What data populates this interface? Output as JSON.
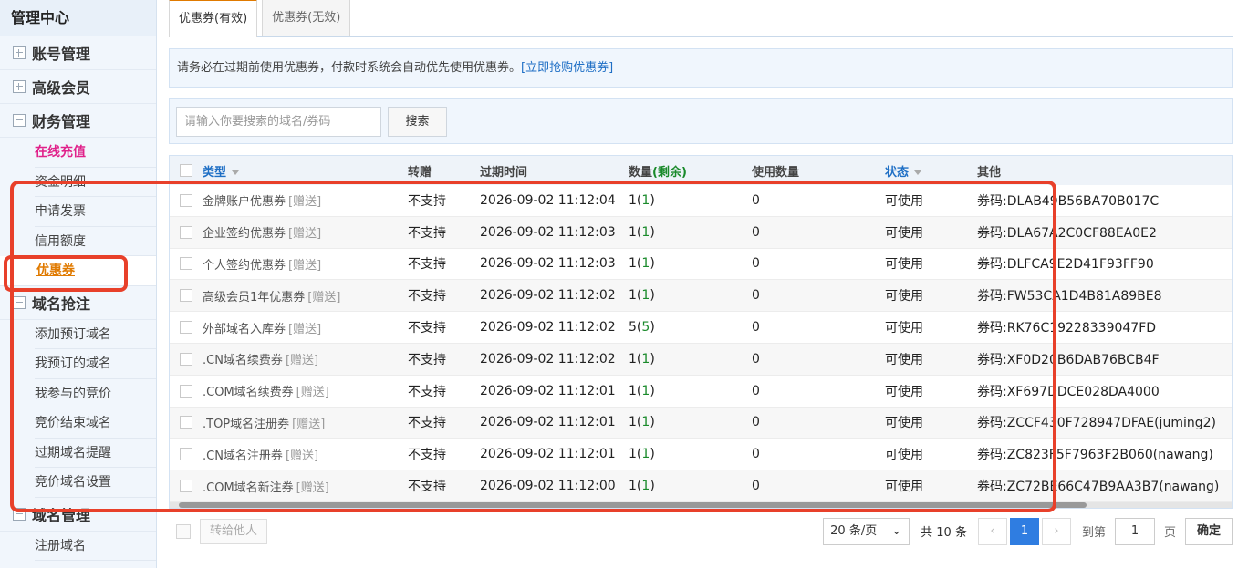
{
  "sidebar": {
    "title": "管理中心",
    "groups": [
      {
        "label": "账号管理",
        "expanded": false,
        "items": []
      },
      {
        "label": "高级会员",
        "expanded": false,
        "items": []
      },
      {
        "label": "财务管理",
        "expanded": true,
        "items": [
          "在线充值",
          "资金明细",
          "申请发票",
          "信用额度",
          "优惠券"
        ]
      },
      {
        "label": "域名抢注",
        "expanded": true,
        "items": [
          "添加预订域名",
          "我预订的域名",
          "我参与的竞价",
          "竞价结束域名",
          "过期域名提醒",
          "竞价域名设置"
        ]
      },
      {
        "label": "域名管理",
        "expanded": true,
        "items": [
          "注册域名"
        ]
      }
    ],
    "active_item": "优惠券",
    "highlight_item": "在线充值"
  },
  "tabs": [
    {
      "label": "优惠券(有效)",
      "active": true
    },
    {
      "label": "优惠券(无效)",
      "active": false
    }
  ],
  "notice": {
    "text": "请务必在过期前使用优惠券，付款时系统会自动优先使用优惠券。",
    "link": "[立即抢购优惠券]"
  },
  "search": {
    "placeholder": "请输入你要搜索的域名/券码",
    "button": "搜索"
  },
  "table": {
    "headers": {
      "type": "类型",
      "gift": "转赠",
      "expire": "过期时间",
      "qty": "数量",
      "qty_remain": "(剩余)",
      "used": "使用数量",
      "status": "状态",
      "other": "其他"
    },
    "rows": [
      {
        "type": "金牌账户优惠券",
        "tag": "[赠送]",
        "gift": "不支持",
        "expire": "2026-09-02 11:12:04",
        "qty": "1",
        "remain": "1",
        "used": "0",
        "status": "可使用",
        "other": "券码:DLAB49B56BA70B017C"
      },
      {
        "type": "企业签约优惠券",
        "tag": "[赠送]",
        "gift": "不支持",
        "expire": "2026-09-02 11:12:03",
        "qty": "1",
        "remain": "1",
        "used": "0",
        "status": "可使用",
        "other": "券码:DLA67A2C0CF88EA0E2"
      },
      {
        "type": "个人签约优惠券",
        "tag": "[赠送]",
        "gift": "不支持",
        "expire": "2026-09-02 11:12:03",
        "qty": "1",
        "remain": "1",
        "used": "0",
        "status": "可使用",
        "other": "券码:DLFCA9E2D41F93FF90"
      },
      {
        "type": "高级会员1年优惠券",
        "tag": "[赠送]",
        "gift": "不支持",
        "expire": "2026-09-02 11:12:02",
        "qty": "1",
        "remain": "1",
        "used": "0",
        "status": "可使用",
        "other": "券码:FW53CA1D4B81A89BE8"
      },
      {
        "type": "外部域名入库券",
        "tag": "[赠送]",
        "gift": "不支持",
        "expire": "2026-09-02 11:12:02",
        "qty": "5",
        "remain": "5",
        "used": "0",
        "status": "可使用",
        "other": "券码:RK76C19228339047FD"
      },
      {
        "type": ".CN域名续费券",
        "tag": "[赠送]",
        "gift": "不支持",
        "expire": "2026-09-02 11:12:02",
        "qty": "1",
        "remain": "1",
        "used": "0",
        "status": "可使用",
        "other": "券码:XF0D20B6DAB76BCB4F"
      },
      {
        "type": ".COM域名续费券",
        "tag": "[赠送]",
        "gift": "不支持",
        "expire": "2026-09-02 11:12:01",
        "qty": "1",
        "remain": "1",
        "used": "0",
        "status": "可使用",
        "other": "券码:XF697DDCE028DA4000"
      },
      {
        "type": ".TOP域名注册券",
        "tag": "[赠送]",
        "gift": "不支持",
        "expire": "2026-09-02 11:12:01",
        "qty": "1",
        "remain": "1",
        "used": "0",
        "status": "可使用",
        "other": "券码:ZCCF430F728947DFAE(juming2)"
      },
      {
        "type": ".CN域名注册券",
        "tag": "[赠送]",
        "gift": "不支持",
        "expire": "2026-09-02 11:12:01",
        "qty": "1",
        "remain": "1",
        "used": "0",
        "status": "可使用",
        "other": "券码:ZC823F5F7963F2B060(nawang)"
      },
      {
        "type": ".COM域名新注券",
        "tag": "[赠送]",
        "gift": "不支持",
        "expire": "2026-09-02 11:12:00",
        "qty": "1",
        "remain": "1",
        "used": "0",
        "status": "可使用",
        "other": "券码:ZC72BE66C47B9AA3B7(nawang)"
      }
    ]
  },
  "footer": {
    "transfer_button": "转给他人",
    "page_size": "20 条/页",
    "total": "共 10 条",
    "prev": "‹",
    "current_page": "1",
    "next": "›",
    "goto_label": "到第",
    "goto_value": "1",
    "page_unit": "页",
    "confirm": "确定"
  },
  "colors": {
    "accent": "#e07a00",
    "link": "#1f6fc5",
    "remain": "#1a8a2b",
    "highlight_box": "#e8402a",
    "page_active": "#2f7de1"
  }
}
